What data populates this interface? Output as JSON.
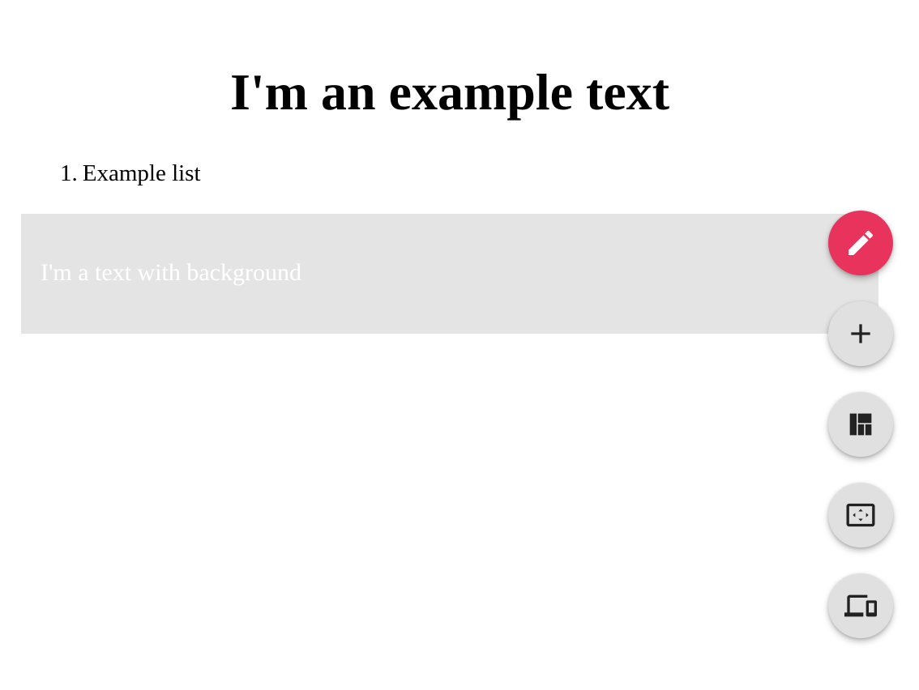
{
  "page": {
    "title": "I'm an example text"
  },
  "list": {
    "items": [
      {
        "number": "1.",
        "label": "Example list"
      }
    ]
  },
  "background_block": {
    "text": "I'm a text with background",
    "background_color": "#e4e4e4",
    "text_color": "#ffffff"
  },
  "fab_menu": {
    "primary_color": "#e8335d",
    "secondary_color": "#e0e0e0",
    "buttons": [
      {
        "icon": "pencil-icon"
      },
      {
        "icon": "plus-icon"
      },
      {
        "icon": "layout-icon"
      },
      {
        "icon": "fit-screen-icon"
      },
      {
        "icon": "devices-icon"
      }
    ]
  }
}
